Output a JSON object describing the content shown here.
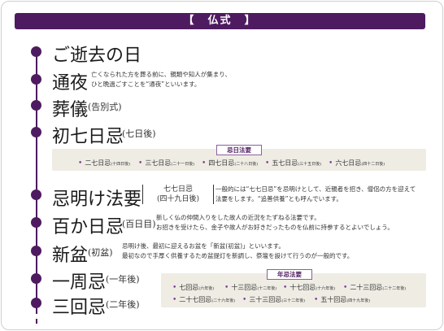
{
  "header": {
    "title": "【　仏式　】"
  },
  "rows": [
    {
      "title": "ご逝去の日",
      "sub": "",
      "desc": []
    },
    {
      "title": "通夜",
      "sub": "",
      "desc": [
        "亡くなられた方を葬る前に、親類や知人が集まり、",
        "ひと晩過ごすことを“通夜”といいます。"
      ]
    },
    {
      "title": "葬儀",
      "sub": "(告別式)",
      "desc": []
    },
    {
      "title": "初七日忌",
      "sub": "(七日後)",
      "desc": []
    },
    {
      "title": "忌明け法要",
      "sub": "",
      "bracket": [
        "七七日忌",
        "(四十九日後)"
      ],
      "desc": [
        "一般的には“七七日忌”を忌明けとして、近親者を招き、僧侶の方を迎えて",
        "法要をします。“追善供養”とも呼んでいます。"
      ]
    },
    {
      "title": "百か日忌",
      "sub": "(百日目)",
      "desc": [
        "新しく仏の仲間入りをした故人の近況をたずねる法要です。",
        "お招きを受けたら、金子や故人がお好きだったものを仏前に持参するとよいでしょう。"
      ]
    },
    {
      "title": "新盆",
      "sub": "(初盆)",
      "desc": [
        "忌明け後、最初に迎えるお盆を「新盆(初盆)」といいます。",
        "最初なので手厚く供養するため盆提灯を新調し、祭壇を設けて行うのが一般的です。"
      ]
    },
    {
      "title": "一周忌",
      "sub": "(一年後)",
      "desc": []
    },
    {
      "title": "三回忌",
      "sub": "(二年後)",
      "desc": []
    }
  ],
  "kinichi": {
    "label": "忌日法要",
    "items": [
      {
        "name": "二七日忌",
        "note": "(十四日後)"
      },
      {
        "name": "三七日忌",
        "note": "(二十一日後)"
      },
      {
        "name": "四七日忌",
        "note": "(二十八日後)"
      },
      {
        "name": "五七日忌",
        "note": "(三十五日後)"
      },
      {
        "name": "六七日忌",
        "note": "(四十二日後)"
      }
    ]
  },
  "nenki": {
    "label": "年忌法要",
    "items": [
      {
        "name": "七回忌",
        "note": "(六年後)"
      },
      {
        "name": "十三回忌",
        "note": "(十二年後)"
      },
      {
        "name": "十七回忌",
        "note": "(十六年後)"
      },
      {
        "name": "二十三回忌",
        "note": "(二十二年後)"
      },
      {
        "name": "二十七回忌",
        "note": "(二十六年後)"
      },
      {
        "name": "三十三回忌",
        "note": "(三十二年後)"
      },
      {
        "name": "五十回忌",
        "note": "(四十九年後)"
      }
    ]
  },
  "colors": {
    "accent": "#4e1b60",
    "box": "#efece4"
  }
}
